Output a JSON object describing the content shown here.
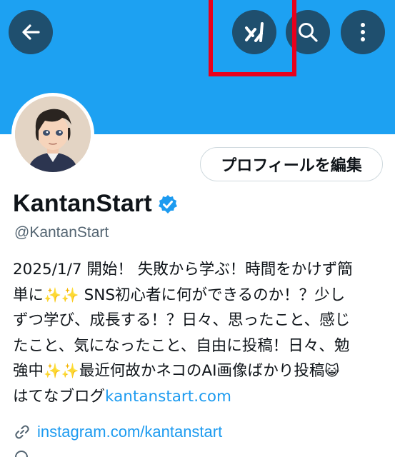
{
  "header": {
    "back_icon": "arrow-left-icon",
    "grok_icon": "grok-icon",
    "search_icon": "search-icon",
    "more_icon": "more-vertical-icon",
    "banner_color": "#1da1f2",
    "highlight_color": "#e8001c"
  },
  "profile": {
    "edit_button_label": "プロフィールを編集",
    "display_name": "KantanStart",
    "handle": "@KantanStart",
    "verified": true,
    "bio_line1": "2025/1/7 開始！ 失敗から学ぶ！時間をかけず簡",
    "bio_line2a": "単に",
    "bio_line2b": " SNS初心者に何ができるのか！？少し",
    "bio_line3": "ずつ学び、成長する！？日々、思ったこと、感じ",
    "bio_line4": "たこと、気になったこと、自由に投稿！日々、勉",
    "bio_line5a": "強中",
    "bio_line5b": "最近何故かネコのAI画像ばかり投稿",
    "bio_line6a": "はてなブログ",
    "bio_line6_link": "kantanstart.com",
    "sparkles": "✨✨",
    "cat_emoji": "😺",
    "website": "instagram.com/kantanstart"
  }
}
